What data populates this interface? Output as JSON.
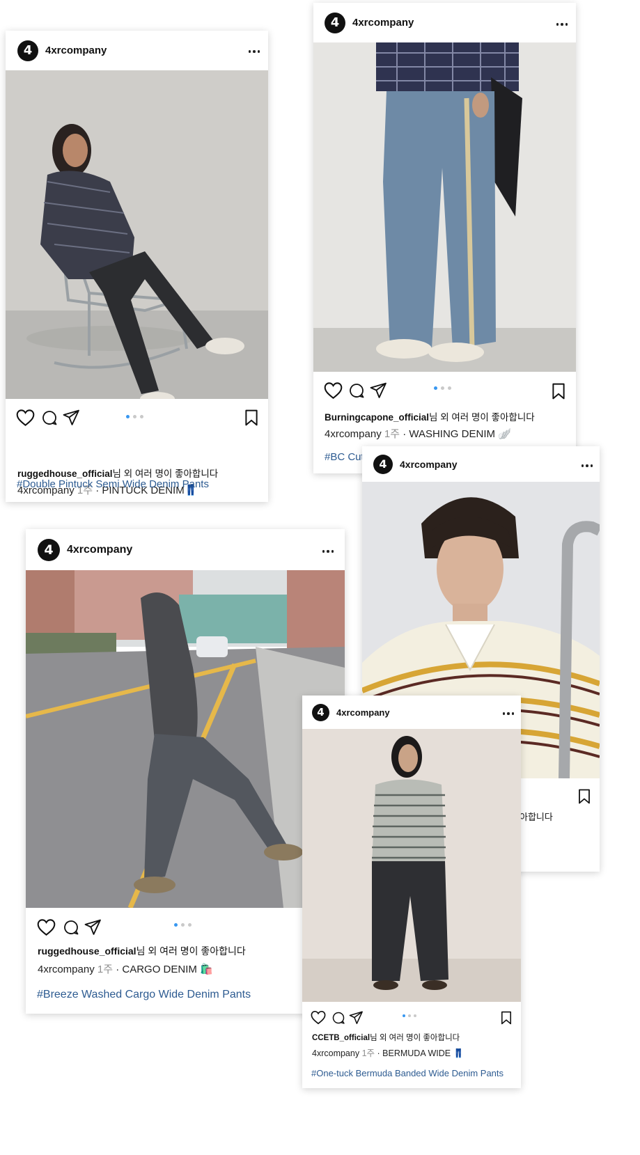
{
  "posts": [
    {
      "username": "4xrcompany",
      "logo_glyph": "4",
      "liker": "ruggedhouse_official",
      "likes_suffix": "님 외 여러 명이 좋아합니다",
      "caption_user": "4xrcompany",
      "caption_age": "1주",
      "caption_text": "· PINTUCK DENIM👖",
      "hashtag": "#Double Pintuck Semi Wide Denim Pants",
      "photo": "man-sitting-on-chair-plaid-shirt-dark-denim"
    },
    {
      "username": "4xrcompany",
      "logo_glyph": "4",
      "liker": "Burningcapone_official",
      "likes_suffix": "님 외 여러 명이 좋아합니다",
      "caption_user": "4xrcompany",
      "caption_age": "1주",
      "caption_text": "· WASHING DENIM 🪽",
      "hashtag": "#BC Cutc",
      "photo": "legs-in-washed-wide-jeans-with-frayed-side-seam"
    },
    {
      "username": "4xrcompany",
      "logo_glyph": "4",
      "likes_partial": "아합니다",
      "photo": "young-man-in-striped-polo-knit"
    },
    {
      "username": "4xrcompany",
      "logo_glyph": "4",
      "liker": "ruggedhouse_official",
      "likes_suffix": "님 외 여러 명이 좋아합니다",
      "caption_user": "4xrcompany",
      "caption_age": "1주",
      "caption_text": "· CARGO DENIM 🛍️",
      "hashtag": "#Breeze Washed Cargo Wide Denim Pants",
      "photo": "man-in-hoodie-crossing-street-cargo-jeans"
    },
    {
      "username": "4xrcompany",
      "logo_glyph": "4",
      "liker": "CCETB_official",
      "likes_suffix": "님 외 여러 명이 좋아합니다",
      "caption_user": "4xrcompany",
      "caption_age": "1주",
      "caption_text": "· BERMUDA WIDE 👖",
      "hashtag": "#One-tuck Bermuda Banded Wide Denim Pants",
      "photo": "man-in-striped-knit-and-wide-denim-standing"
    }
  ],
  "icons": [
    "heart-icon",
    "comment-icon",
    "share-icon",
    "bookmark-icon",
    "more-icon"
  ],
  "colors": {
    "hashtag": "#2d5b91",
    "dot_active": "#3897f0",
    "dot_inactive": "#c9c9c9",
    "time": "#8e8e8e"
  }
}
